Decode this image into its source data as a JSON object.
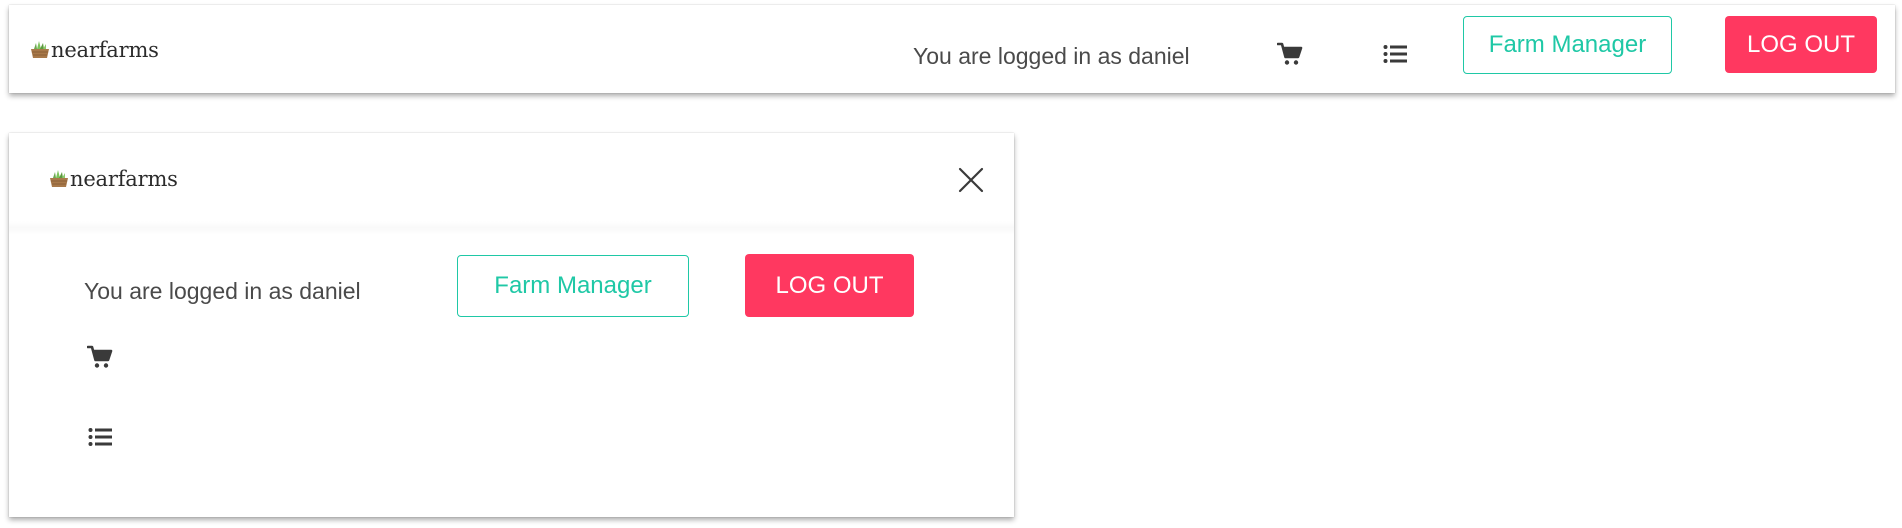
{
  "brand": {
    "name": "nearfarms",
    "icon": "basket-logo-icon"
  },
  "navbar": {
    "logged_in_text": "You are logged in as daniel",
    "cart_icon": "cart-icon",
    "list_icon": "list-icon",
    "farm_manager_label": "Farm Manager",
    "logout_label": "LOG OUT"
  },
  "mobile_menu": {
    "close_icon": "close-icon",
    "logged_in_text": "You are logged in as daniel",
    "farm_manager_label": "Farm Manager",
    "logout_label": "LOG OUT",
    "cart_icon": "cart-icon",
    "list_icon": "list-icon"
  },
  "colors": {
    "primary_outline": "#1fc8a6",
    "danger": "#ff3860",
    "text": "#4a4a4a",
    "icon": "#3a3a3a"
  }
}
